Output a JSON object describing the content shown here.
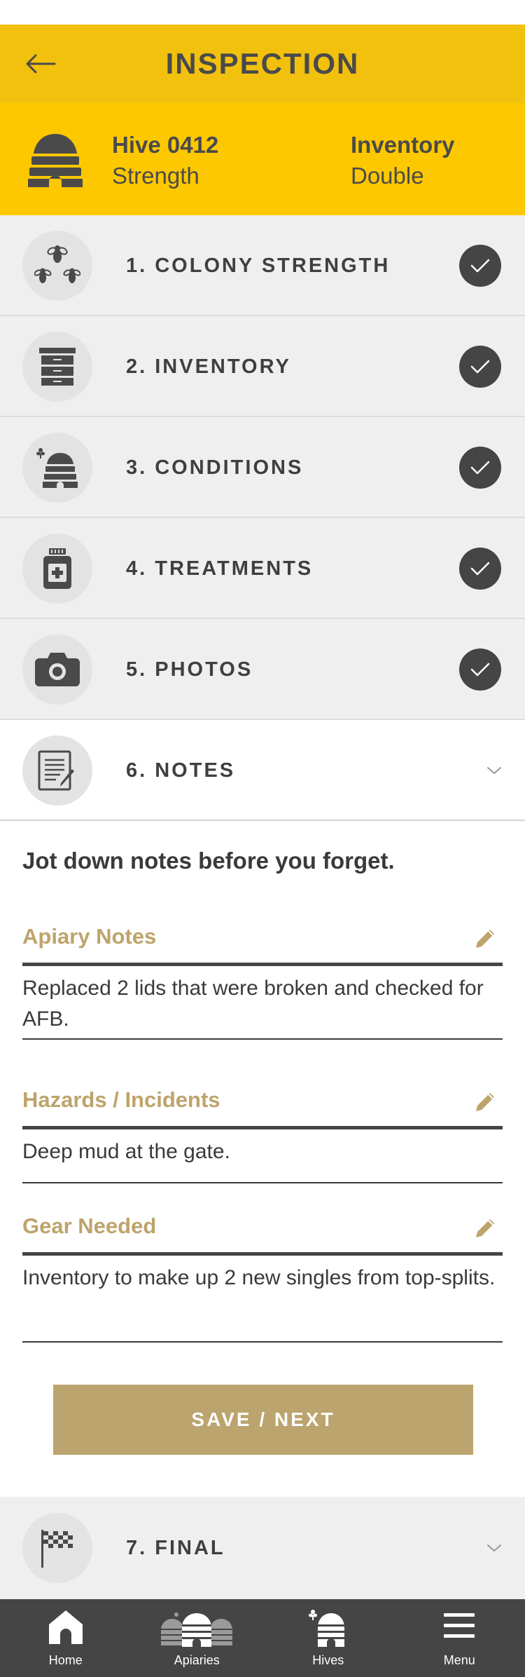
{
  "header": {
    "title": "INSPECTION"
  },
  "hive": {
    "name_label": "Hive 0412",
    "name_value": "Strength",
    "type_label": "Inventory",
    "type_value": "Double"
  },
  "steps": [
    {
      "label": "1. COLONY STRENGTH",
      "icon": "bees-icon",
      "status": "complete"
    },
    {
      "label": "2. INVENTORY",
      "icon": "hive-box-icon",
      "status": "complete"
    },
    {
      "label": "3. CONDITIONS",
      "icon": "skep-icon",
      "status": "complete"
    },
    {
      "label": "4. TREATMENTS",
      "icon": "medicine-bottle-icon",
      "status": "complete"
    },
    {
      "label": "5. PHOTOS",
      "icon": "camera-icon",
      "status": "complete"
    },
    {
      "label": "6. NOTES",
      "icon": "notepad-icon",
      "status": "expanded"
    },
    {
      "label": "7. FINAL",
      "icon": "checkered-flag-icon",
      "status": "collapsed"
    }
  ],
  "notes": {
    "prompt": "Jot down notes before you forget.",
    "fields": [
      {
        "label": "Apiary Notes",
        "value": "Replaced 2 lids that were broken and checked for AFB."
      },
      {
        "label": "Hazards / Incidents",
        "value": "Deep mud at the gate."
      },
      {
        "label": "Gear Needed",
        "value": "Inventory to make up 2 new singles from top-splits."
      }
    ],
    "save_label": "SAVE / NEXT"
  },
  "tabbar": {
    "items": [
      {
        "label": "Home",
        "icon": "home-icon"
      },
      {
        "label": "Apiaries",
        "icon": "apiaries-icon"
      },
      {
        "label": "Hives",
        "icon": "hive-icon"
      },
      {
        "label": "Menu",
        "icon": "menu-icon"
      }
    ]
  },
  "colors": {
    "topbar": "#f2c10e",
    "hive_header": "#fdc800",
    "accent_gold": "#bea46b",
    "dark": "#454545",
    "step_bg": "#efefef"
  }
}
